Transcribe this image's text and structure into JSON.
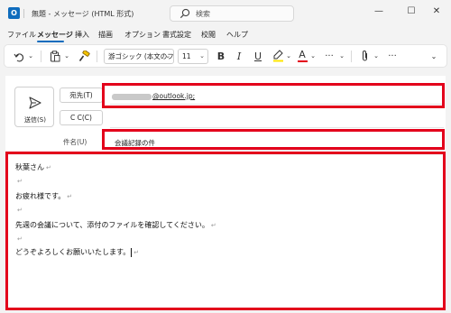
{
  "window": {
    "title": "無題 - メッセージ (HTML 形式)",
    "search_placeholder": "検索",
    "minimize": "—",
    "maximize": "☐",
    "close": "✕"
  },
  "menu": [
    "ファイル",
    "メッセージ",
    "挿入",
    "描画",
    "オプション",
    "書式設定",
    "校閲",
    "ヘルプ"
  ],
  "toolbar": {
    "font_name": "游ゴシック (本文のフォ",
    "font_size": "11",
    "bold": "B",
    "italic": "I",
    "underline": "U",
    "font_color_letter": "A",
    "more": "···",
    "accent_color": "#0f6cbd",
    "highlight_color": "#ffe500",
    "font_color": "#e3001b"
  },
  "compose": {
    "send_label": "送信(S)",
    "to_button": "宛先(T)",
    "cc_button": "C C(C)",
    "to_value": "@outlook.jp;",
    "subject_label": "件名(U)",
    "subject_value": "会議記録の件"
  },
  "body": {
    "lines": [
      "秋葉さん",
      "",
      "お疲れ様です。",
      "",
      "先週の会議について、添付のファイルを確認してください。",
      "",
      "どうぞよろしくお願いいたします。"
    ],
    "paragraph_mark": "↵"
  },
  "highlight_color": "#e3001b"
}
